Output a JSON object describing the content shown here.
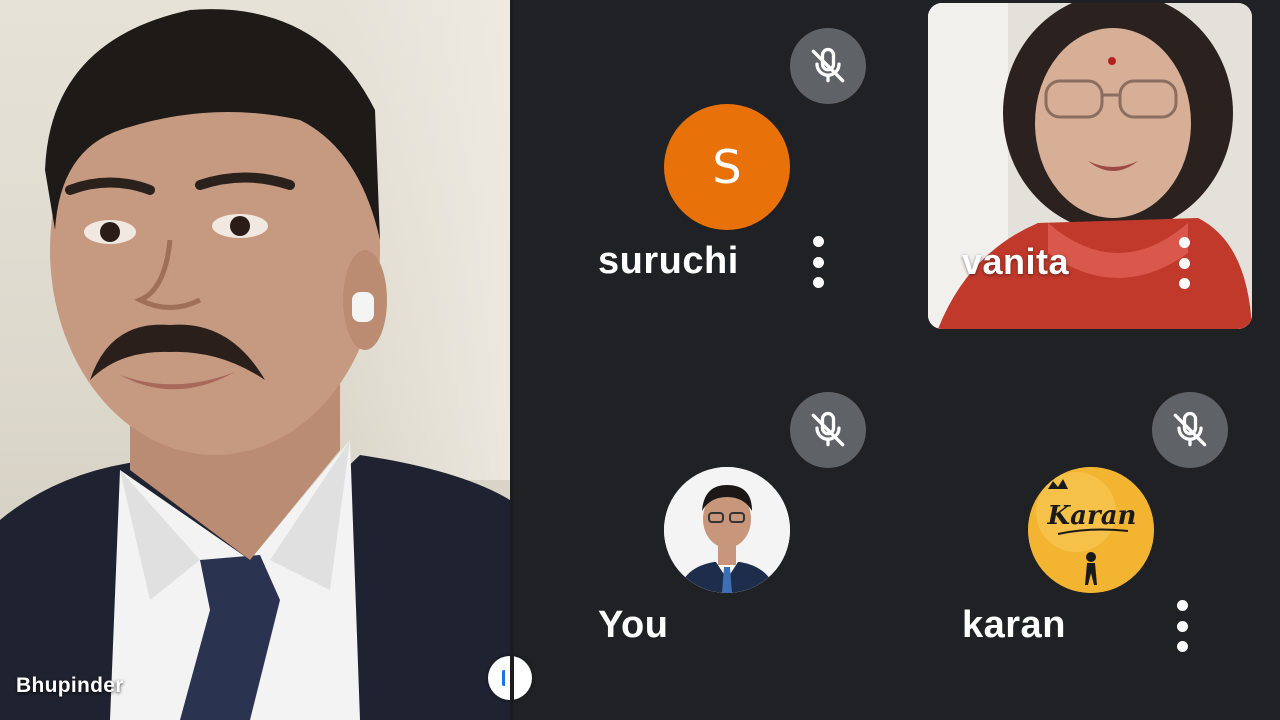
{
  "main_speaker": {
    "name": "Bhupinder"
  },
  "participants": [
    {
      "id": "suruchi",
      "name": "suruchi",
      "avatar_letter": "S",
      "avatar_color": "#e8710a",
      "muted": true,
      "mute_icon": "mic-off-icon"
    },
    {
      "id": "vanita",
      "name": "vanita",
      "video_on": true,
      "mute_icon": "none"
    },
    {
      "id": "you",
      "name": "You",
      "muted": true,
      "avatar_type": "photo",
      "mute_icon": "mic-off-icon"
    },
    {
      "id": "karan",
      "name": "karan",
      "muted": true,
      "avatar_type": "logo",
      "avatar_logo_text": "Karan",
      "avatar_color": "#f2b431",
      "mute_icon": "mic-off-icon"
    }
  ],
  "colors": {
    "background": "#202124",
    "mute_button": "#5f6368",
    "text": "#ffffff"
  },
  "icons": {
    "mute": "mic-off-icon",
    "more": "more-vert-icon"
  }
}
